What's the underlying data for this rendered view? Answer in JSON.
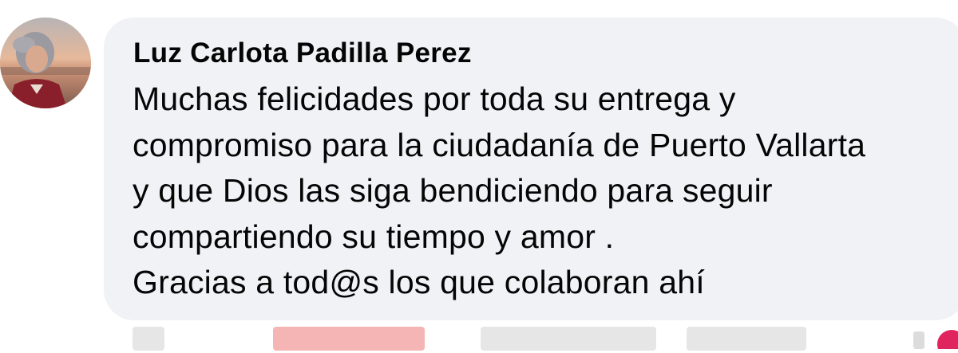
{
  "comment": {
    "author": "Luz Carlota Padilla Perez",
    "lines": [
      "Muchas felicidades por toda su entrega y",
      "compromiso para la ciudadanía de Puerto Vallarta",
      "y que Dios las siga bendiciendo para seguir",
      "compartiendo su tiempo y amor .",
      "Gracias a tod@s los que colaboran ahí"
    ]
  },
  "colors": {
    "bubble": "#f0f2f5",
    "text": "#050505",
    "reaction_accent": "#e0245e"
  },
  "icons": {
    "avatar": "profile-photo",
    "reaction": "heart-reaction-icon"
  }
}
